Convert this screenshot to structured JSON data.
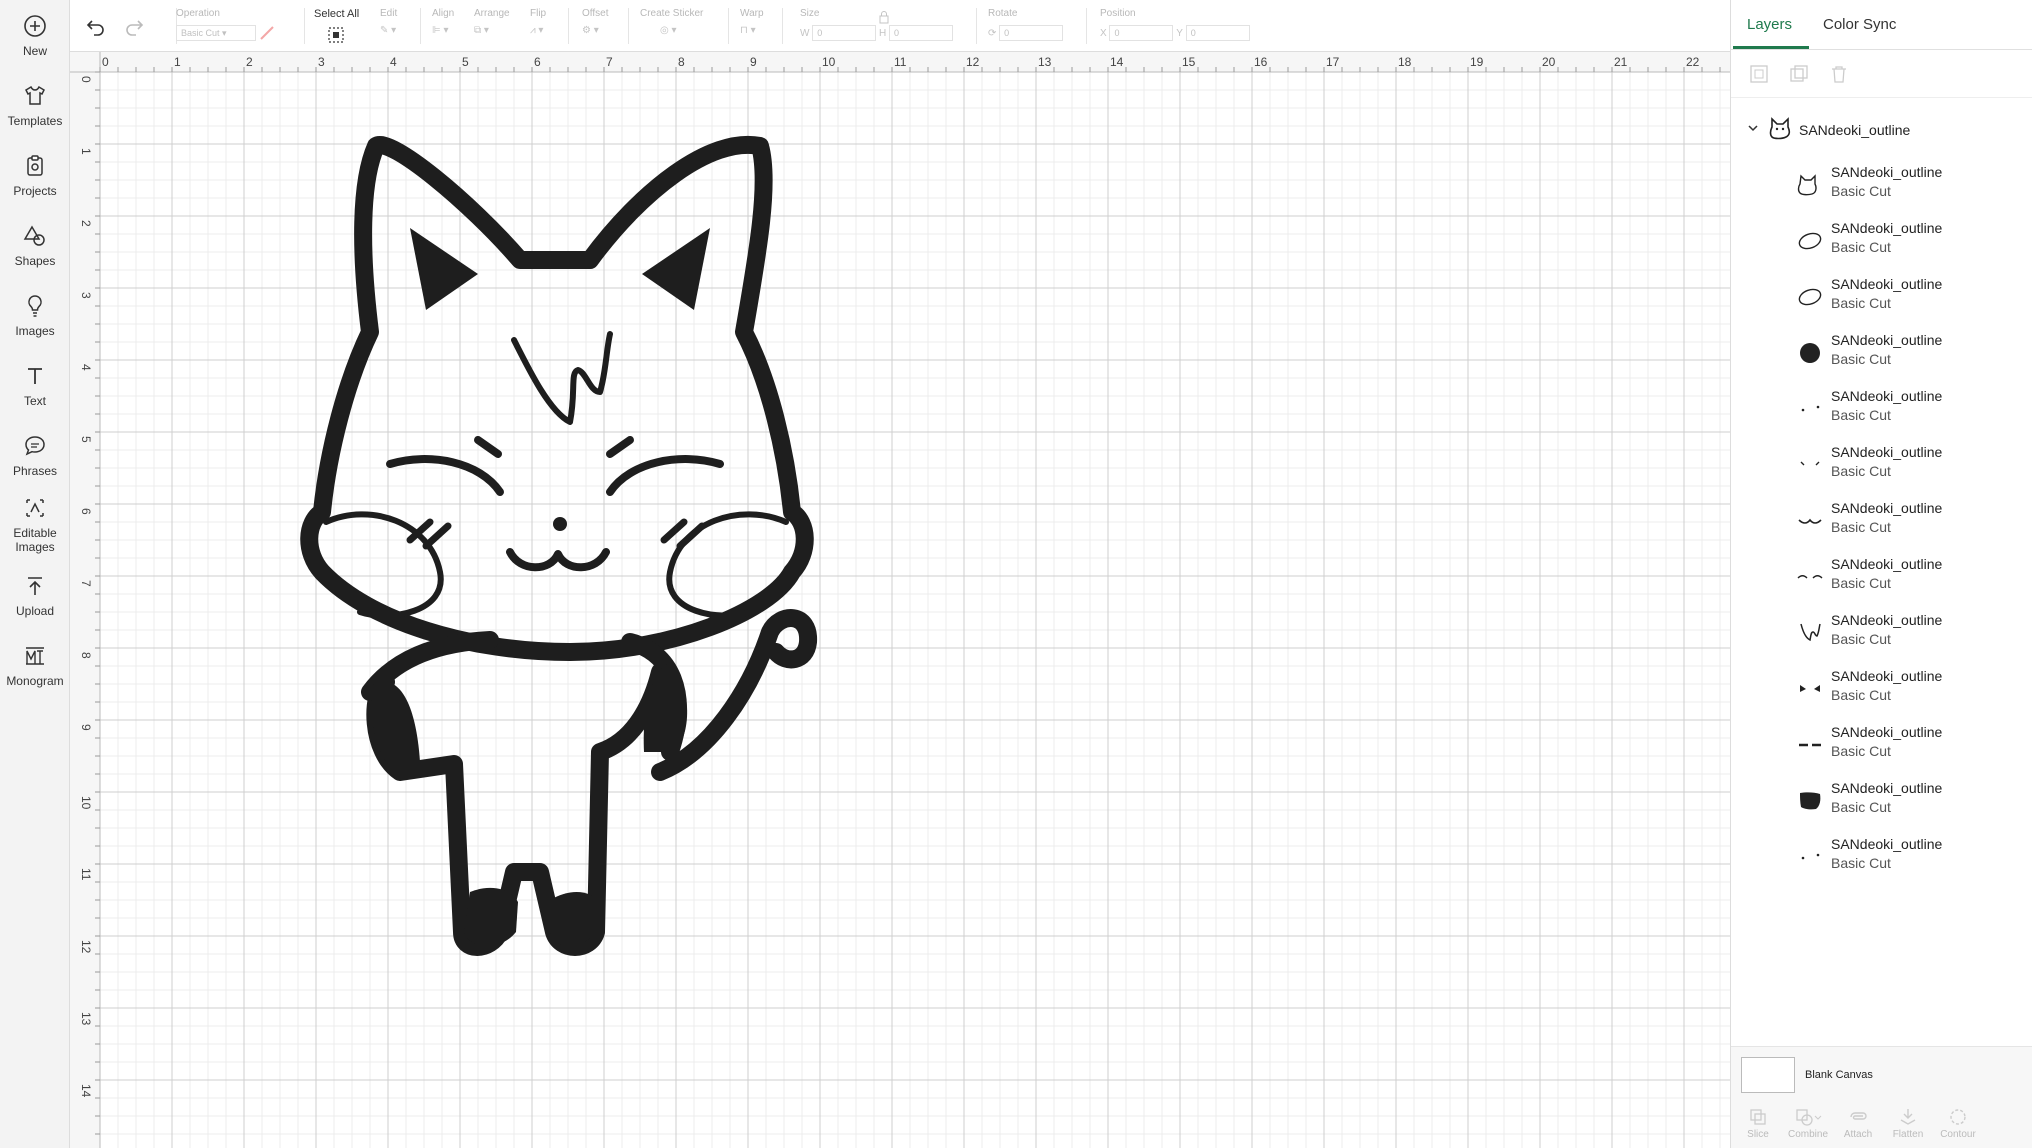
{
  "sidebar": {
    "items": [
      {
        "label": "New",
        "icon": "plus-circle-icon"
      },
      {
        "label": "Templates",
        "icon": "shirt-icon"
      },
      {
        "label": "Projects",
        "icon": "clipboard-icon"
      },
      {
        "label": "Shapes",
        "icon": "shapes-icon"
      },
      {
        "label": "Images",
        "icon": "bulb-icon"
      },
      {
        "label": "Text",
        "icon": "text-icon"
      },
      {
        "label": "Phrases",
        "icon": "speech-bubble-icon"
      },
      {
        "label": "Editable Images",
        "icon": "editable-image-icon"
      },
      {
        "label": "Upload",
        "icon": "upload-icon"
      },
      {
        "label": "Monogram",
        "icon": "monogram-icon"
      }
    ]
  },
  "toolbar": {
    "operation_label": "Operation",
    "operation_value": "Basic Cut",
    "select_all_label": "Select All",
    "edit_label": "Edit",
    "align_label": "Align",
    "arrange_label": "Arrange",
    "flip_label": "Flip",
    "offset_label": "Offset",
    "create_sticker_label": "Create Sticker",
    "warp_label": "Warp",
    "size_label": "Size",
    "size_w": "W",
    "size_h": "H",
    "size_w_value": "0",
    "size_h_value": "0",
    "rotate_label": "Rotate",
    "rotate_value": "0",
    "position_label": "Position",
    "pos_x": "X",
    "pos_y": "Y",
    "pos_x_value": "0",
    "pos_y_value": "0"
  },
  "ruler": {
    "top": [
      "0",
      "1",
      "2",
      "3",
      "4",
      "5",
      "6",
      "7",
      "8",
      "9",
      "10",
      "11",
      "12",
      "13",
      "14",
      "15",
      "16",
      "17",
      "18",
      "19",
      "20",
      "21",
      "22"
    ],
    "left": [
      "0",
      "1",
      "2",
      "3",
      "4",
      "5",
      "6",
      "7",
      "8",
      "9",
      "10",
      "11",
      "12",
      "13",
      "14"
    ]
  },
  "panel": {
    "tabs": [
      "Layers",
      "Color Sync"
    ],
    "group_name": "SANdeoki_outline",
    "layers": [
      {
        "name": "SANdeoki_outline",
        "op": "Basic Cut",
        "thumb": "cat-outline-icon"
      },
      {
        "name": "SANdeoki_outline",
        "op": "Basic Cut",
        "thumb": "ellipse-outline-icon"
      },
      {
        "name": "SANdeoki_outline",
        "op": "Basic Cut",
        "thumb": "ellipse-outline-icon"
      },
      {
        "name": "SANdeoki_outline",
        "op": "Basic Cut",
        "thumb": "circle-filled-icon"
      },
      {
        "name": "SANdeoki_outline",
        "op": "Basic Cut",
        "thumb": "dots-icon"
      },
      {
        "name": "SANdeoki_outline",
        "op": "Basic Cut",
        "thumb": "dashes-icon"
      },
      {
        "name": "SANdeoki_outline",
        "op": "Basic Cut",
        "thumb": "mouth-icon"
      },
      {
        "name": "SANdeoki_outline",
        "op": "Basic Cut",
        "thumb": "brows-icon"
      },
      {
        "name": "SANdeoki_outline",
        "op": "Basic Cut",
        "thumb": "w-letter-icon"
      },
      {
        "name": "SANdeoki_outline",
        "op": "Basic Cut",
        "thumb": "triangles-icon"
      },
      {
        "name": "SANdeoki_outline",
        "op": "Basic Cut",
        "thumb": "eyes-icon"
      },
      {
        "name": "SANdeoki_outline",
        "op": "Basic Cut",
        "thumb": "blob-filled-icon"
      },
      {
        "name": "SANdeoki_outline",
        "op": "Basic Cut",
        "thumb": "dots-icon"
      }
    ],
    "blank_canvas_label": "Blank Canvas",
    "bottom_tools": [
      "Slice",
      "Combine",
      "Attach",
      "Flatten",
      "Contour"
    ]
  }
}
